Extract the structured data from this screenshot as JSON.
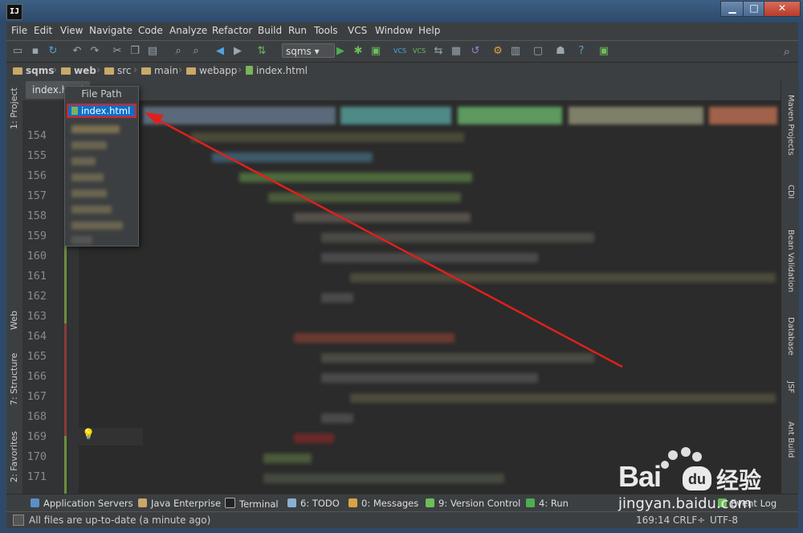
{
  "window": {
    "app_logo": "IJ",
    "minimize": "▁",
    "maximize": "□",
    "close": "✕"
  },
  "menu": [
    "File",
    "Edit",
    "View",
    "Navigate",
    "Code",
    "Analyze",
    "Refactor",
    "Build",
    "Run",
    "Tools",
    "VCS",
    "Window",
    "Help"
  ],
  "toolbar": {
    "run_config": "sqms",
    "icons": [
      "open-folder-icon",
      "save-icon",
      "sync-icon",
      "undo-icon",
      "redo-icon",
      "cut-icon",
      "copy-icon",
      "paste-icon",
      "find-icon",
      "replace-icon",
      "back-icon",
      "forward-icon",
      "make-icon",
      "run-icon",
      "debug-icon",
      "coverage-icon",
      "vcs-update-icon",
      "vcs-commit-icon",
      "compare-icon",
      "history-icon",
      "revert-icon",
      "settings-icon",
      "structure-icon",
      "sdk-icon",
      "android-icon",
      "help-icon",
      "tasks-icon"
    ],
    "search_icon": "search-icon"
  },
  "breadcrumbs": [
    {
      "label": "sqms",
      "bold": true
    },
    {
      "label": "web",
      "bold": true
    },
    {
      "label": "src",
      "bold": false
    },
    {
      "label": "main",
      "bold": false
    },
    {
      "label": "webapp",
      "bold": false
    },
    {
      "label": "index.html",
      "bold": false
    }
  ],
  "left_tools": [
    "1: Project",
    "Web",
    "7: Structure",
    "2: Favorites"
  ],
  "right_tools": [
    "Maven Projects",
    "CDI",
    "Bean Validation",
    "Database",
    "JSF",
    "Ant Build"
  ],
  "tab": {
    "label": "index.html"
  },
  "line_numbers": [
    "154",
    "155",
    "156",
    "157",
    "158",
    "159",
    "160",
    "161",
    "162",
    "163",
    "164",
    "165",
    "166",
    "167",
    "168",
    "169",
    "170",
    "171"
  ],
  "popup": {
    "title": "File Path",
    "selected": "index.html"
  },
  "tool_windows": [
    "Application Servers",
    "Java Enterprise",
    "Terminal",
    "6: TODO",
    "0: Messages",
    "9: Version Control",
    "4: Run",
    "Event Log"
  ],
  "status": {
    "message": "All files are up-to-date (a minute ago)",
    "position": "169:14",
    "line_sep": "CRLF÷",
    "encoding": "UTF-8"
  },
  "watermark": {
    "brand": "Bai",
    "brand2": "du",
    "cn": "经验",
    "url": "jingyan.baidu.com"
  },
  "colors": {
    "accent_red": "#e0201b",
    "selection_blue": "#0d6fc7"
  }
}
